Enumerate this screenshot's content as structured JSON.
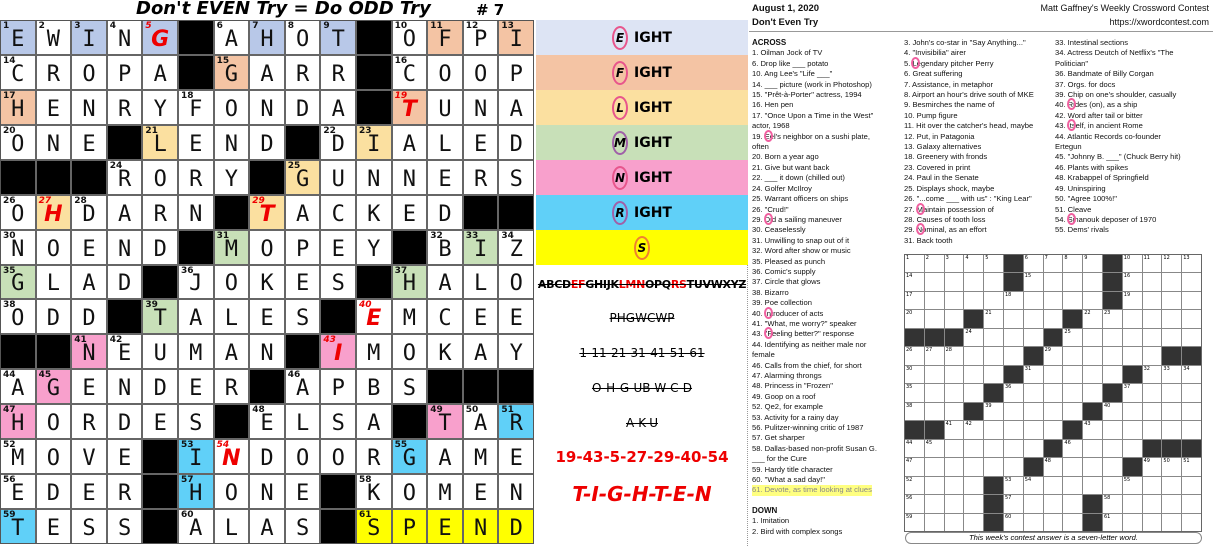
{
  "left": {
    "title": "Don't EVEN Try = Do ODD Try",
    "puzzle_number": "# 7",
    "grid": {
      "rows": [
        "EWING#AHOT#OFPI",
        "CROPA#GARR#COOP",
        "HENRYFONDA#TUNA",
        "ONE#LEND#DIALED",
        "###RORY#GUNNERS",
        "OHDARN#TACKED##",
        "NOEND#MOPEY#BIZ",
        "GLAD#JOKES#HALO",
        "ODD#TALES#EMCEE",
        "##NEUMAN#IMOKAY",
        "AGENDER#APBS###",
        "HORDES#ELSA#TAR",
        "MOVE#INDOORGAME",
        "EDER#HONE#KOMEN",
        "TESS#ALAS#SPEND"
      ],
      "red_letter_cells": [
        [
          0,
          4
        ],
        [
          2,
          11
        ],
        [
          5,
          1
        ],
        [
          5,
          7
        ],
        [
          8,
          10
        ],
        [
          9,
          9
        ],
        [
          12,
          6
        ]
      ],
      "shaded": {
        "blue": [
          [
            0,
            0
          ],
          [
            0,
            2
          ],
          [
            0,
            4
          ],
          [
            0,
            7
          ],
          [
            0,
            9
          ]
        ],
        "orange": [
          [
            0,
            12
          ],
          [
            0,
            14
          ],
          [
            1,
            6
          ],
          [
            2,
            0
          ],
          [
            2,
            11
          ]
        ],
        "tan": [
          [
            3,
            4
          ],
          [
            3,
            10
          ],
          [
            4,
            8
          ],
          [
            5,
            1
          ],
          [
            5,
            7
          ]
        ],
        "green": [
          [
            6,
            6
          ],
          [
            6,
            13
          ],
          [
            7,
            0
          ],
          [
            7,
            11
          ],
          [
            8,
            4
          ]
        ],
        "pink": [
          [
            9,
            2
          ],
          [
            9,
            9
          ],
          [
            10,
            1
          ],
          [
            11,
            0
          ],
          [
            11,
            12
          ]
        ],
        "cyan": [
          [
            11,
            14
          ],
          [
            12,
            5
          ],
          [
            12,
            11
          ],
          [
            13,
            5
          ],
          [
            14,
            0
          ]
        ],
        "yellow": [
          [
            14,
            10
          ],
          [
            14,
            11
          ],
          [
            14,
            12
          ],
          [
            14,
            13
          ],
          [
            14,
            14
          ]
        ]
      },
      "colors": {
        "blue": "#b8c8e8",
        "orange": "#f4c4a4",
        "tan": "#fbe0a0",
        "green": "#c8e0b8",
        "pink": "#f8a0cc",
        "cyan": "#60d0f8",
        "yellow": "#ffff00",
        "red": "#e00000"
      }
    }
  },
  "middle": {
    "bands": [
      {
        "letter": "E",
        "suffix": "IGHT",
        "color": "#dde4f4"
      },
      {
        "letter": "F",
        "suffix": "IGHT",
        "color": "#f4c4a4"
      },
      {
        "letter": "L",
        "suffix": "IGHT",
        "color": "#fbe0a0"
      },
      {
        "letter": "M",
        "suffix": "IGHT",
        "color": "#c8e0b8"
      },
      {
        "letter": "N",
        "suffix": "IGHT",
        "color": "#f8a0cc"
      },
      {
        "letter": "R",
        "suffix": "IGHT",
        "color": "#60d0f8"
      },
      {
        "letter": "S",
        "suffix": "",
        "color": "#ffff00"
      }
    ],
    "alphabet": {
      "parts": [
        "ABCD",
        "EF",
        "GHIJK",
        "LMN",
        "OPQ",
        "RS",
        "TUVWXYZ"
      ]
    },
    "struck_lines": [
      "PHGWCWP",
      "1-11-21-31-41-51-61",
      "O-H-G-UB-W-C-D",
      "A-K-U"
    ],
    "numbers_line": "19-43-5-27-29-40-54",
    "answer_line": "T-I-G-H-T-E-N"
  },
  "right": {
    "date": "August 1, 2020",
    "puzzle_title": "Don't Even Try",
    "contest_name": "Matt Gaffney's Weekly Crossword Contest",
    "url": "https://xwordcontest.com",
    "across_header": "ACROSS",
    "down_header": "DOWN",
    "col1": [
      "1. Oilman Jock of TV",
      "6. Drop like ___ potato",
      "10. Ang Lee's \"Life ___\"",
      "14. ___ picture (work in Photoshop)",
      "15. \"Prêt-à-Porter\" actress, 1994",
      "16. Hen pen",
      "17. \"Once Upon a Time in the West\"",
      "actor, 1968",
      "19. Eel's neighbor on a sushi plate,",
      "often",
      "20. Born a year ago",
      "21. Give but want back",
      "22. ___ it down (chilled out)",
      "24. Golfer McIlroy",
      "25. Warrant officers on ships",
      "26. \"Crud!\"",
      "29. Did a sailing maneuver",
      "30. Ceaselessly",
      "31. Unwilling to snap out of it",
      "32. Word after show or music",
      "35. Pleased as punch",
      "36. Comic's supply",
      "37. Circle that glows",
      "38. Bizarro",
      "39. Poe collection",
      "40. Introducer of acts",
      "41. \"What, me worry?\" speaker",
      "43. \"Feeling better?\" response",
      "44. Identifying as neither male nor",
      "female",
      "46. Calls from the chief, for short",
      "47. Alarming throngs",
      "48. Princess in \"Frozen\"",
      "49. Goop on a roof",
      "52. Qe2, for example",
      "53. Activity for a rainy day",
      "56. Pulitzer-winning critic of 1987",
      "57. Get sharper",
      "58. Dallas-based non-profit Susan G.",
      "___ for the Cure",
      "59. Hardy title character",
      "60. \"What a sad day!\""
    ],
    "highlighted_clue": "61. Devote, as time looking at clues",
    "down_col1": [
      "1. Imitation",
      "2. Bird with complex songs"
    ],
    "col2": [
      "3. John's co-star in \"Say Anything...\"",
      "4. \"Invisibilia\" airer",
      "5. Legendary pitcher Perry",
      "6. Great suffering",
      "7. Assistance, in metaphor",
      "8. Airport an hour's drive south of MKE",
      "9. Besmirches the name of",
      "10. Pump figure",
      "11. Hit over the catcher's head, maybe",
      "12. Put, in Patagonia",
      "13. Galaxy alternatives",
      "18. Greenery with fronds",
      "23. Covered in print",
      "24. Paul in the Senate",
      "25. Displays shock, maybe",
      "26. \"...come ___ with us\" : \"King Lear\"",
      "27. Maintain possession of",
      "28. Causes of tooth loss",
      "29. Nominal, as an effort",
      "31. Back tooth"
    ],
    "col3": [
      "33. Intestinal sections",
      "34. Actress Deutch of Netflix's \"The",
      "Politician\"",
      "36. Bandmate of Billy Corgan",
      "37. Orgs. for docs",
      "39. Chip on one's shoulder, casually",
      "40. Rides (on), as a ship",
      "42. Word after tail or bitter",
      "43. Itself, in ancient Rome",
      "44. Atlantic Records co-founder",
      "Ertegun",
      "45. \"Johnny B. ___\" (Chuck Berry hit)",
      "46. Plants with spikes",
      "48. Krabappel of Springfield",
      "49. Uninspiring",
      "50. \"Agree 100%!\"",
      "51. Cleave",
      "54. Sihanouk deposer of 1970",
      "55. Dems' rivals"
    ],
    "circled_clues": [
      "19",
      "43",
      "5",
      "27",
      "29",
      "40",
      "54"
    ],
    "contest_answer_note": "This week's contest answer is a seven-letter word."
  }
}
